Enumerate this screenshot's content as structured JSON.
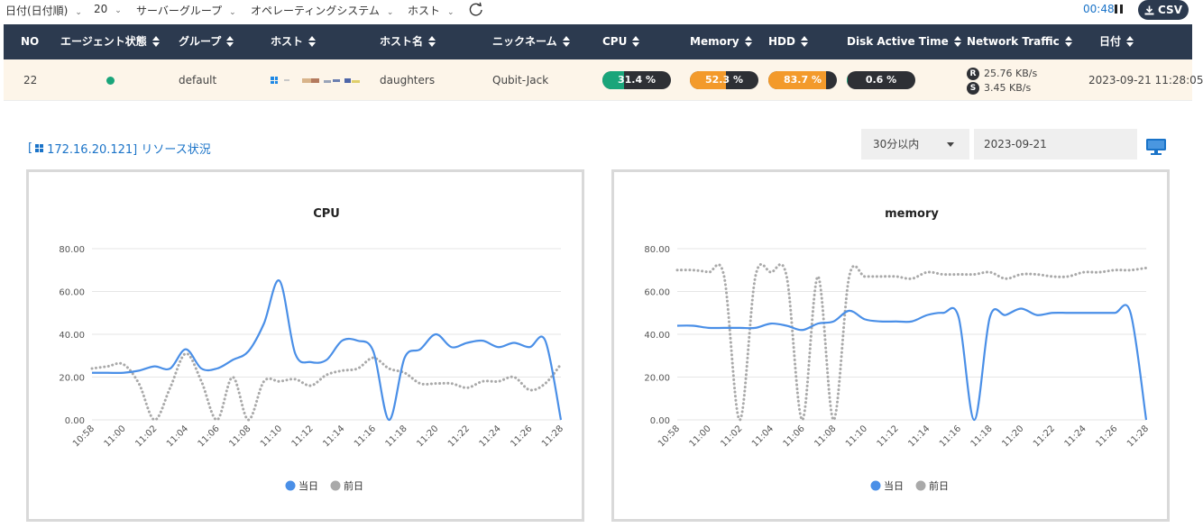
{
  "filters": {
    "sort": "日付(日付順)",
    "count": "20",
    "server_group": "サーバーグループ",
    "os": "オペレーティングシステム",
    "host": "ホスト",
    "timer": "00:48",
    "csv_label": "CSV"
  },
  "table": {
    "headers": [
      "NO",
      "エージェント状態",
      "グループ",
      "ホスト",
      "ホスト名",
      "ニックネーム",
      "CPU",
      "Memory",
      "HDD",
      "Disk Active Time",
      "Network Traffic",
      "日付"
    ],
    "row": {
      "no": "22",
      "agent_status_color": "#1aa57a",
      "group": "default",
      "host_icon": "windows-icon",
      "hostname": "daughters",
      "nickname": "Qubit-Jack",
      "cpu": {
        "label": "31.4 %",
        "value": 31.4,
        "color": "#1aa57a"
      },
      "memory": {
        "label": "52.3 %",
        "value": 52.3,
        "color": "#f39a2b"
      },
      "hdd": {
        "label": "83.7 %",
        "value": 83.7,
        "color": "#f39a2b"
      },
      "disk_active": {
        "label": "0.6 %",
        "value": 0.6,
        "color": "#1aa57a"
      },
      "net_r_badge": "R",
      "net_r": "25.76 KB/s",
      "net_s_badge": "S",
      "net_s": "3.45 KB/s",
      "date": "2023-09-21 11:28:05"
    }
  },
  "section": {
    "title_open": "[",
    "title_rest": "172.16.20.121] リソース状況",
    "range_select": "30分以内",
    "date_value": "2023-09-21"
  },
  "chart_data": [
    {
      "type": "line",
      "title": "CPU",
      "xlabel": "",
      "ylabel": "",
      "ylim": [
        0,
        80
      ],
      "yticks": [
        "80.00",
        "60.00",
        "40.00",
        "20.00",
        "0.00"
      ],
      "x": [
        "10:58",
        "10:59",
        "11:00",
        "11:01",
        "11:02",
        "11:03",
        "11:04",
        "11:05",
        "11:06",
        "11:07",
        "11:08",
        "11:09",
        "11:10",
        "11:11",
        "11:12",
        "11:13",
        "11:14",
        "11:15",
        "11:16",
        "11:17",
        "11:18",
        "11:19",
        "11:20",
        "11:21",
        "11:22",
        "11:23",
        "11:24",
        "11:25",
        "11:26",
        "11:27",
        "11:28"
      ],
      "x_tick_labels": [
        "10:58",
        "11:00",
        "11:02",
        "11:04",
        "11:06",
        "11:08",
        "11:10",
        "11:12",
        "11:14",
        "11:16",
        "11:18",
        "11:20",
        "11:22",
        "11:24",
        "11:26",
        "11:28"
      ],
      "legend_position": "bottom",
      "series": [
        {
          "name": "当日",
          "color": "#4a8fe7",
          "style": "solid",
          "values": [
            22,
            22,
            22,
            23,
            25,
            24,
            33,
            24,
            24,
            28,
            32,
            45,
            65,
            31,
            27,
            28,
            37,
            37,
            32,
            0,
            29,
            33,
            40,
            34,
            36,
            37,
            34,
            36,
            34,
            37,
            0
          ]
        },
        {
          "name": "前日",
          "color": "#a9a9a9",
          "style": "dotted",
          "values": [
            24,
            25,
            26,
            17,
            0,
            15,
            31,
            18,
            0,
            20,
            0,
            18,
            18,
            19,
            16,
            21,
            23,
            24,
            29,
            24,
            22,
            17,
            17,
            17,
            15,
            18,
            18,
            20,
            14,
            17,
            26
          ]
        }
      ]
    },
    {
      "type": "line",
      "title": "memory",
      "xlabel": "",
      "ylabel": "",
      "ylim": [
        0,
        80
      ],
      "yticks": [
        "80.00",
        "60.00",
        "40.00",
        "20.00",
        "0.00"
      ],
      "x": [
        "10:58",
        "10:59",
        "11:00",
        "11:01",
        "11:02",
        "11:03",
        "11:04",
        "11:05",
        "11:06",
        "11:07",
        "11:08",
        "11:09",
        "11:10",
        "11:11",
        "11:12",
        "11:13",
        "11:14",
        "11:15",
        "11:16",
        "11:17",
        "11:18",
        "11:19",
        "11:20",
        "11:21",
        "11:22",
        "11:23",
        "11:24",
        "11:25",
        "11:26",
        "11:27",
        "11:28"
      ],
      "x_tick_labels": [
        "10:58",
        "11:00",
        "11:02",
        "11:04",
        "11:06",
        "11:08",
        "11:10",
        "11:12",
        "11:14",
        "11:16",
        "11:18",
        "11:20",
        "11:22",
        "11:24",
        "11:26",
        "11:28"
      ],
      "legend_position": "bottom",
      "series": [
        {
          "name": "当日",
          "color": "#4a8fe7",
          "style": "solid",
          "values": [
            44,
            44,
            43,
            43,
            43,
            43,
            45,
            44,
            42,
            45,
            46,
            51,
            47,
            46,
            46,
            46,
            49,
            50,
            48,
            0,
            48,
            49,
            52,
            49,
            50,
            50,
            50,
            50,
            50,
            50,
            0
          ]
        },
        {
          "name": "前日",
          "color": "#a9a9a9",
          "style": "dotted",
          "values": [
            70,
            70,
            69,
            67,
            0,
            67,
            69,
            67,
            0,
            67,
            0,
            67,
            67,
            67,
            67,
            66,
            69,
            68,
            68,
            68,
            69,
            66,
            68,
            68,
            67,
            67,
            69,
            69,
            70,
            70,
            71
          ]
        }
      ]
    }
  ]
}
